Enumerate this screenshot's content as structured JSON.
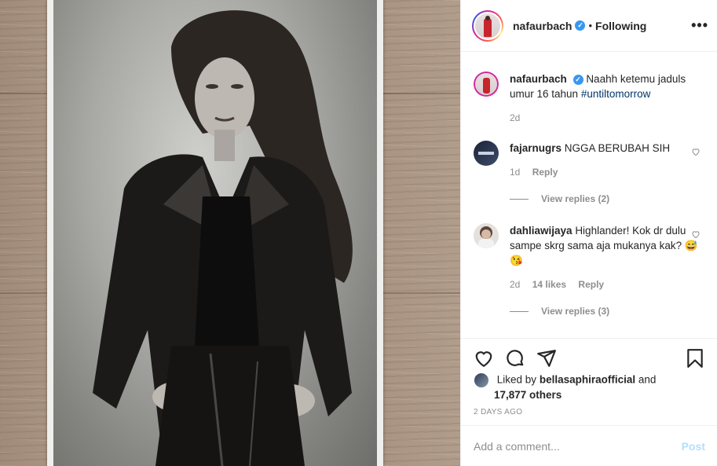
{
  "header": {
    "username": "nafaurbach",
    "follow_state": "Following",
    "separator": "•"
  },
  "caption": {
    "username": "nafaurbach",
    "text": "Naahh ketemu jaduls umur 16 tahun",
    "hashtag": "#untiltomorrow",
    "time": "2d"
  },
  "comments": [
    {
      "username": "fajarnugrs",
      "text": "NGGA BERUBAH SIH",
      "time": "1d",
      "reply_label": "Reply",
      "view_replies": "View replies (2)"
    },
    {
      "username": "dahliawijaya",
      "text": "Highlander! Kok dr dulu sampe skrg sama aja mukanya kak?",
      "emojis": "😅😘",
      "time": "2d",
      "likes": "14 likes",
      "reply_label": "Reply",
      "view_replies": "View replies (3)"
    }
  ],
  "likes": {
    "prefix": "Liked by",
    "user": "bellasaphiraofficial",
    "conj": "and",
    "others": "17,877 others"
  },
  "date": "2 DAYS AGO",
  "add_comment": {
    "placeholder": "Add a comment...",
    "post_label": "Post"
  },
  "colors": {
    "verified": "#3897f0",
    "link": "#00376b",
    "muted": "#8e8e8e",
    "post_disabled": "#b2dffc"
  }
}
